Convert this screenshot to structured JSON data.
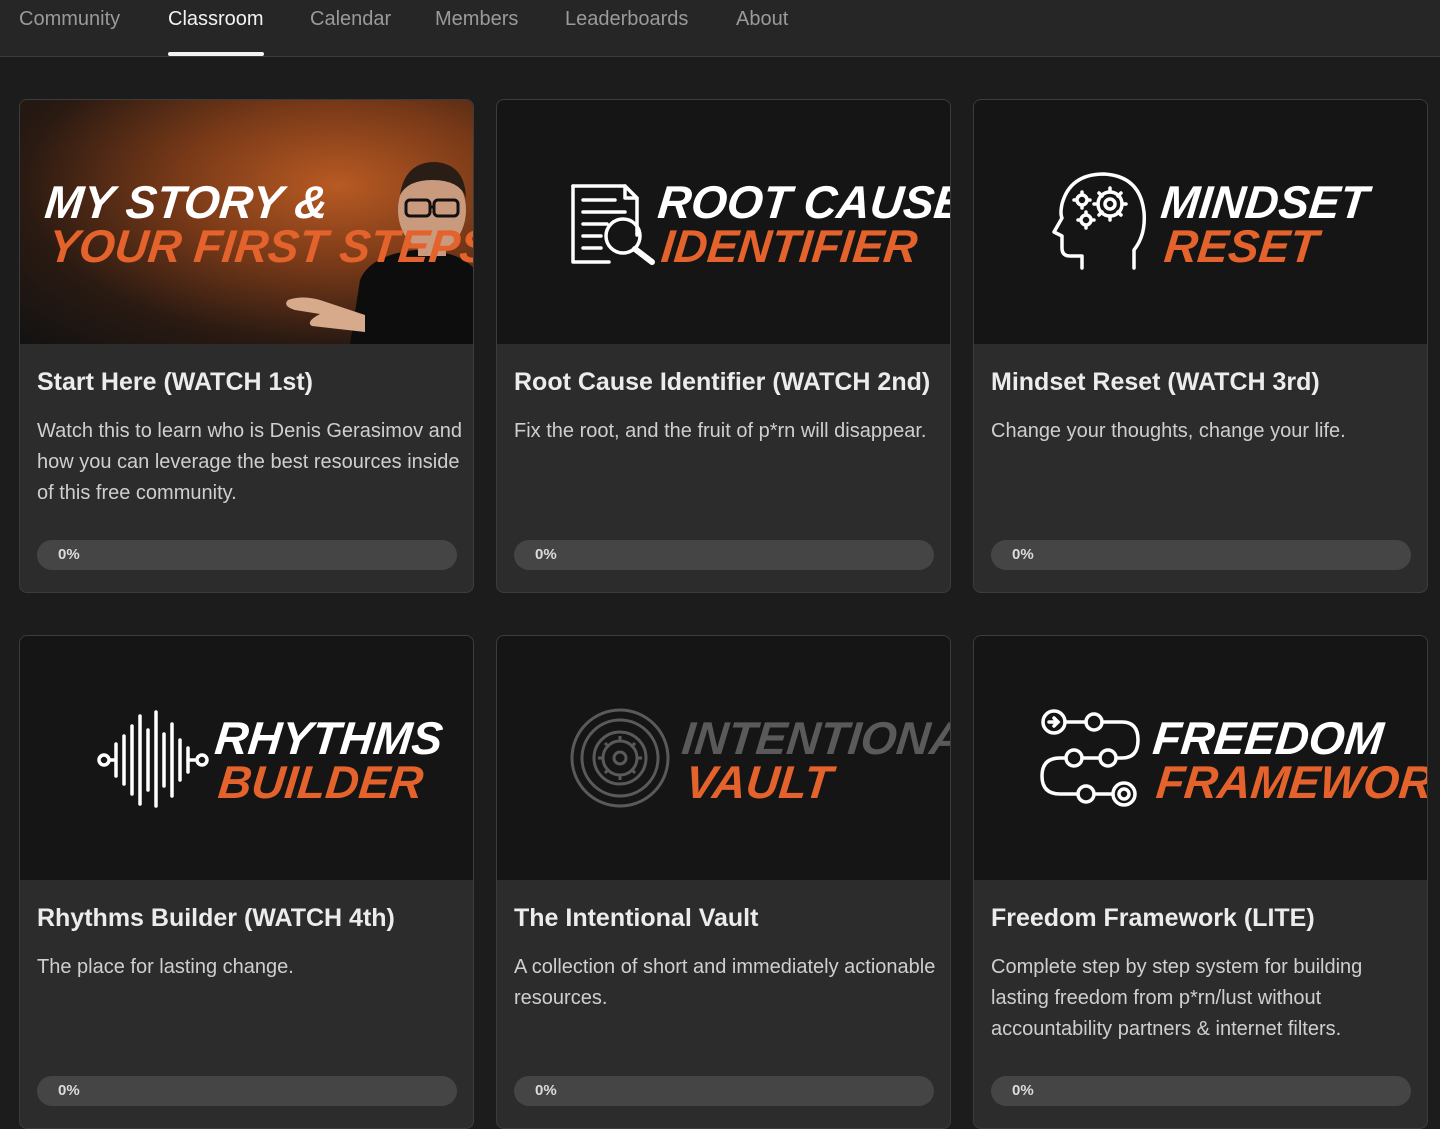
{
  "nav": {
    "tabs": [
      {
        "label": "Community",
        "active": false
      },
      {
        "label": "Classroom",
        "active": true
      },
      {
        "label": "Calendar",
        "active": false
      },
      {
        "label": "Members",
        "active": false
      },
      {
        "label": "Leaderboards",
        "active": false
      },
      {
        "label": "About",
        "active": false
      }
    ]
  },
  "colors": {
    "accent": "#e4622b",
    "thumb_white": "#ffffff",
    "thumb_dim": "#5a5a5a"
  },
  "courses": [
    {
      "thumb_line1": "MY STORY &",
      "thumb_line2": "YOUR FIRST STEPS",
      "icon": "presenter-photo",
      "title": "Start Here (WATCH 1st)",
      "description": "Watch this to learn who is Denis Gerasimov and how you can leverage the best resources inside of this free community.",
      "progress_label": "0%",
      "progress": 0
    },
    {
      "thumb_line1": "ROOT CAUSE",
      "thumb_line2": "IDENTIFIER",
      "icon": "document-search-icon",
      "title": "Root Cause Identifier (WATCH 2nd)",
      "description": "Fix the root, and the fruit of p*rn will disappear.",
      "progress_label": "0%",
      "progress": 0
    },
    {
      "thumb_line1": "MINDSET",
      "thumb_line2": "RESET",
      "icon": "head-gears-icon",
      "title": "Mindset Reset (WATCH 3rd)",
      "description": "Change your thoughts, change your life.",
      "progress_label": "0%",
      "progress": 0
    },
    {
      "thumb_line1": "RHYTHMS",
      "thumb_line2": "BUILDER",
      "icon": "sound-wave-icon",
      "title": "Rhythms Builder (WATCH 4th)",
      "description": "The place for lasting change.",
      "progress_label": "0%",
      "progress": 0
    },
    {
      "thumb_line1": "INTENTIONAL",
      "thumb_line2": "VAULT",
      "icon": "vault-dial-icon",
      "title": "The Intentional Vault",
      "description": "A collection of short and immediately actionable resources.",
      "progress_label": "0%",
      "progress": 0
    },
    {
      "thumb_line1": "FREEDOM",
      "thumb_line2": "FRAMEWORK",
      "icon": "path-flow-icon",
      "title": "Freedom Framework (LITE)",
      "description": "Complete step by step system for building lasting freedom from p*rn/lust without accountability partners & internet filters.",
      "progress_label": "0%",
      "progress": 0
    }
  ]
}
